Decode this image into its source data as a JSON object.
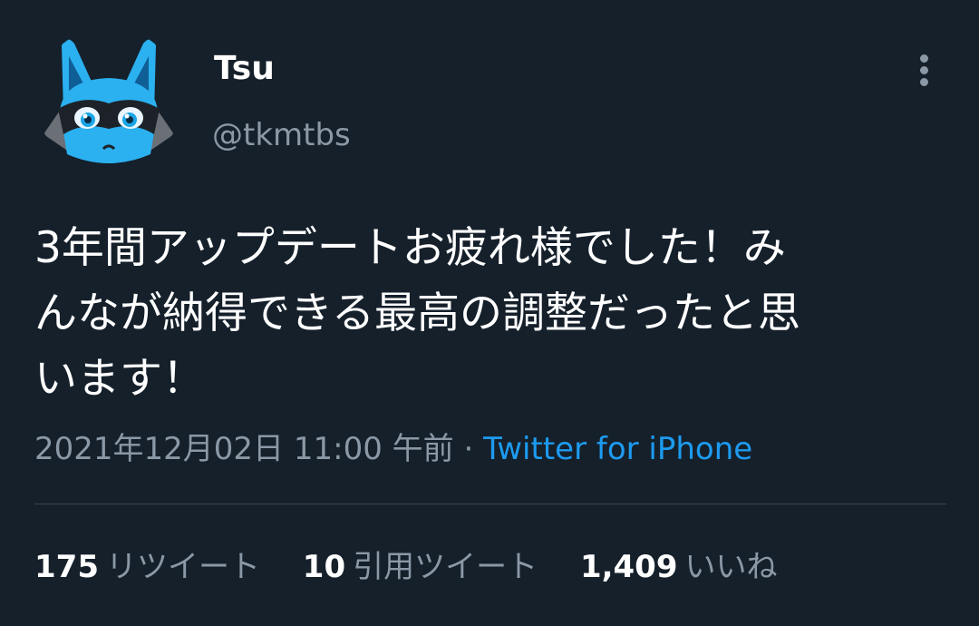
{
  "user": {
    "display_name": "Tsu",
    "handle": "@tkmtbs",
    "avatar_icon": "lucario-face-avatar"
  },
  "tweet": {
    "text_lines": [
      "3年間アップデートお疲れ様でした！み",
      "んなが納得できる最高の調整だったと思",
      "います！"
    ],
    "timestamp": "2021年12月02日 11:00 午前",
    "separator": " · ",
    "source": "Twitter for iPhone"
  },
  "stats": [
    {
      "count": "175",
      "label": "リツイート"
    },
    {
      "count": "10",
      "label": "引用ツイート"
    },
    {
      "count": "1,409",
      "label": "いいね"
    }
  ],
  "icons": {
    "more": "more-vertical-icon"
  },
  "colors": {
    "background": "#15202b",
    "primary_text": "#ffffff",
    "secondary_text": "#8b98a5",
    "link": "#1d9bf0",
    "divider": "#38444d"
  }
}
